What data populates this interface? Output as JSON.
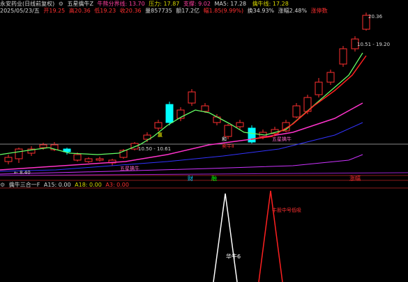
{
  "header": {
    "stock_name": "永安药业(日线前复权)",
    "indicator_name": "五星擒牛Z",
    "items": [
      {
        "text": "牛熊分界线: 13.70",
        "color": "#ff3fa0"
      },
      {
        "text": "压力: 17.87",
        "color": "#d8d800"
      },
      {
        "text": "支撑: 9.02",
        "color": "#ff3fa0"
      },
      {
        "text": "MA5: 17.28",
        "color": "#d8d8d8"
      },
      {
        "text": "",
        "color": "#2020ff"
      },
      {
        "text": "擒牛线: 17.28",
        "color": "#d8d800"
      },
      {
        "text": "",
        "color": "#ff3030"
      }
    ]
  },
  "ohlc_row": {
    "date": "2025/05/23/五",
    "items": [
      {
        "text": "开19.25",
        "color": "#ff3030"
      },
      {
        "text": "高20.36",
        "color": "#ff3030"
      },
      {
        "text": "低19.23",
        "color": "#ff3030"
      },
      {
        "text": "收20.36",
        "color": "#ff3030"
      },
      {
        "text": "量857735",
        "color": "#d8d8d8"
      },
      {
        "text": "额17.2亿",
        "color": "#d8d8d8"
      },
      {
        "text": "幅1.85(9.99%)",
        "color": "#ff3030"
      },
      {
        "text": "换34.93%",
        "color": "#d8d8d8"
      },
      {
        "text": "涨幅2.48%",
        "color": "#d8d8d8"
      },
      {
        "text": "涨停数",
        "color": "#ff3030"
      }
    ]
  },
  "price_labels": {
    "high": "20.36",
    "range_upper": "10.51 - 19.20",
    "range_lower": "10.50 - 10.61",
    "low": "8.40"
  },
  "chart_annotations": {
    "wuxing_1": "五星擒牛",
    "wuxing_2": "五星擒牛",
    "he": "和",
    "ying": "赢",
    "mai_sell": "卖牛Ⅱ"
  },
  "markers": [
    {
      "text": "财",
      "color": "#00d0ff"
    },
    {
      "text": "融",
      "color": "#00ff00"
    },
    {
      "text": "涨幅",
      "color": "#ff3030"
    }
  ],
  "subchart": {
    "title": "擒牛三合一F",
    "items": [
      {
        "text": "A15: 0.00",
        "color": "#d8d8d8"
      },
      {
        "text": "A18: 0.00",
        "color": "#d8d800"
      },
      {
        "text": "A3: 0.00",
        "color": "#ff3030"
      }
    ],
    "white_label": "华牛6",
    "red_label": "牛股中号低吸"
  },
  "colors": {
    "background": "#000000",
    "up": "#ff3030",
    "down": "#00ffff",
    "ma_green": "#66ff66",
    "ma_magenta": "#ff33cc",
    "ma_blue": "#3333ff",
    "ma_purple": "#cc33ff",
    "support_line": "#888888"
  }
}
